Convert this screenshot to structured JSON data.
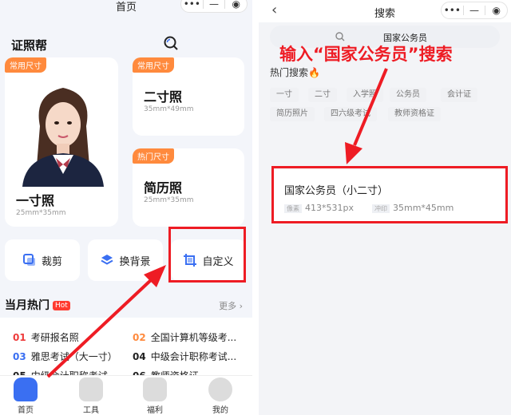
{
  "left": {
    "title": "首页",
    "brand": "证照帮",
    "cards": [
      {
        "tag": "常用尺寸",
        "name": "一寸照",
        "size": "25mm*35mm"
      },
      {
        "tag": "常用尺寸",
        "name": "二寸照",
        "size": "35mm*49mm"
      },
      {
        "tag": "热门尺寸",
        "name": "简历照",
        "size": "25mm*35mm"
      }
    ],
    "tools": {
      "crop": "裁剪",
      "background": "换背景",
      "custom": "自定义"
    },
    "section": {
      "title": "当月热门",
      "badge": "Hot",
      "more": "更多"
    },
    "list": [
      {
        "num": "01",
        "text": "考研报名照"
      },
      {
        "num": "02",
        "text": "全国计算机等级考..."
      },
      {
        "num": "03",
        "text": "雅思考试（大一寸）"
      },
      {
        "num": "04",
        "text": "中级会计职称考试..."
      },
      {
        "num": "05",
        "text": "中级会计职称考试"
      },
      {
        "num": "06",
        "text": "教师资格证"
      }
    ],
    "tabs": [
      "首页",
      "工具",
      "福利",
      "我的"
    ]
  },
  "right": {
    "title": "搜索",
    "query": "国家公务员",
    "annotation": "输入“国家公务员”搜索",
    "hot_title": "热门搜索",
    "chips": [
      "一寸",
      "二寸",
      "入学照",
      "公务员",
      "会计证",
      "简历照片",
      "四六级考试",
      "教师资格证"
    ],
    "result": {
      "name": "国家公务员（小二寸）",
      "pixel_label": "像素",
      "pixel": "413*531px",
      "print_label": "冲印",
      "print": "35mm*45mm"
    }
  },
  "colors": {
    "accent_orange": "#ff8a3d",
    "annotation_red": "#ee1c24",
    "brand_blue": "#3a6ff2"
  }
}
